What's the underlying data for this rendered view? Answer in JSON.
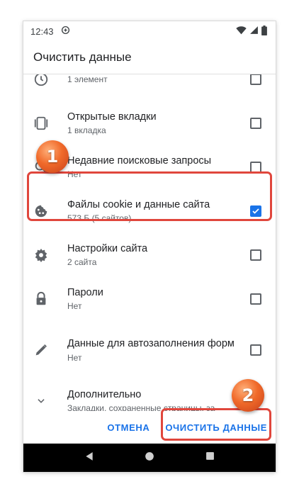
{
  "status_bar": {
    "time": "12:43"
  },
  "dialog": {
    "title": "Очистить данные"
  },
  "items": [
    {
      "icon": "history-icon",
      "title": "",
      "subtitle": "1 элемент",
      "checked": false
    },
    {
      "icon": "tabs-icon",
      "title": "Открытые вкладки",
      "subtitle": "1 вкладка",
      "checked": false
    },
    {
      "icon": "search-icon",
      "title": "Недавние поисковые запросы",
      "subtitle": "Нет",
      "checked": false
    },
    {
      "icon": "cookie-icon",
      "title": "Файлы cookie и данные сайта",
      "subtitle": "573 Б (5 сайтов)",
      "checked": true
    },
    {
      "icon": "gear-icon",
      "title": "Настройки сайта",
      "subtitle": "2 сайта",
      "checked": false
    },
    {
      "icon": "lock-icon",
      "title": "Пароли",
      "subtitle": "Нет",
      "checked": false
    },
    {
      "icon": "pencil-icon",
      "title": "Данные для автозаполнения форм",
      "subtitle": "Нет",
      "checked": false
    },
    {
      "icon": "chevron-down-icon",
      "title": "Дополнительно",
      "subtitle": "Закладки, сохраненные страницы, за"
    }
  ],
  "actions": {
    "cancel_label": "ОТМЕНА",
    "clear_label": "ОЧИСТИТЬ ДАННЫЕ"
  },
  "annotations": {
    "step1": "1",
    "step2": "2"
  },
  "colors": {
    "accent": "#1a73e8",
    "highlight": "#e0463c",
    "marker": "#f06a2a"
  }
}
